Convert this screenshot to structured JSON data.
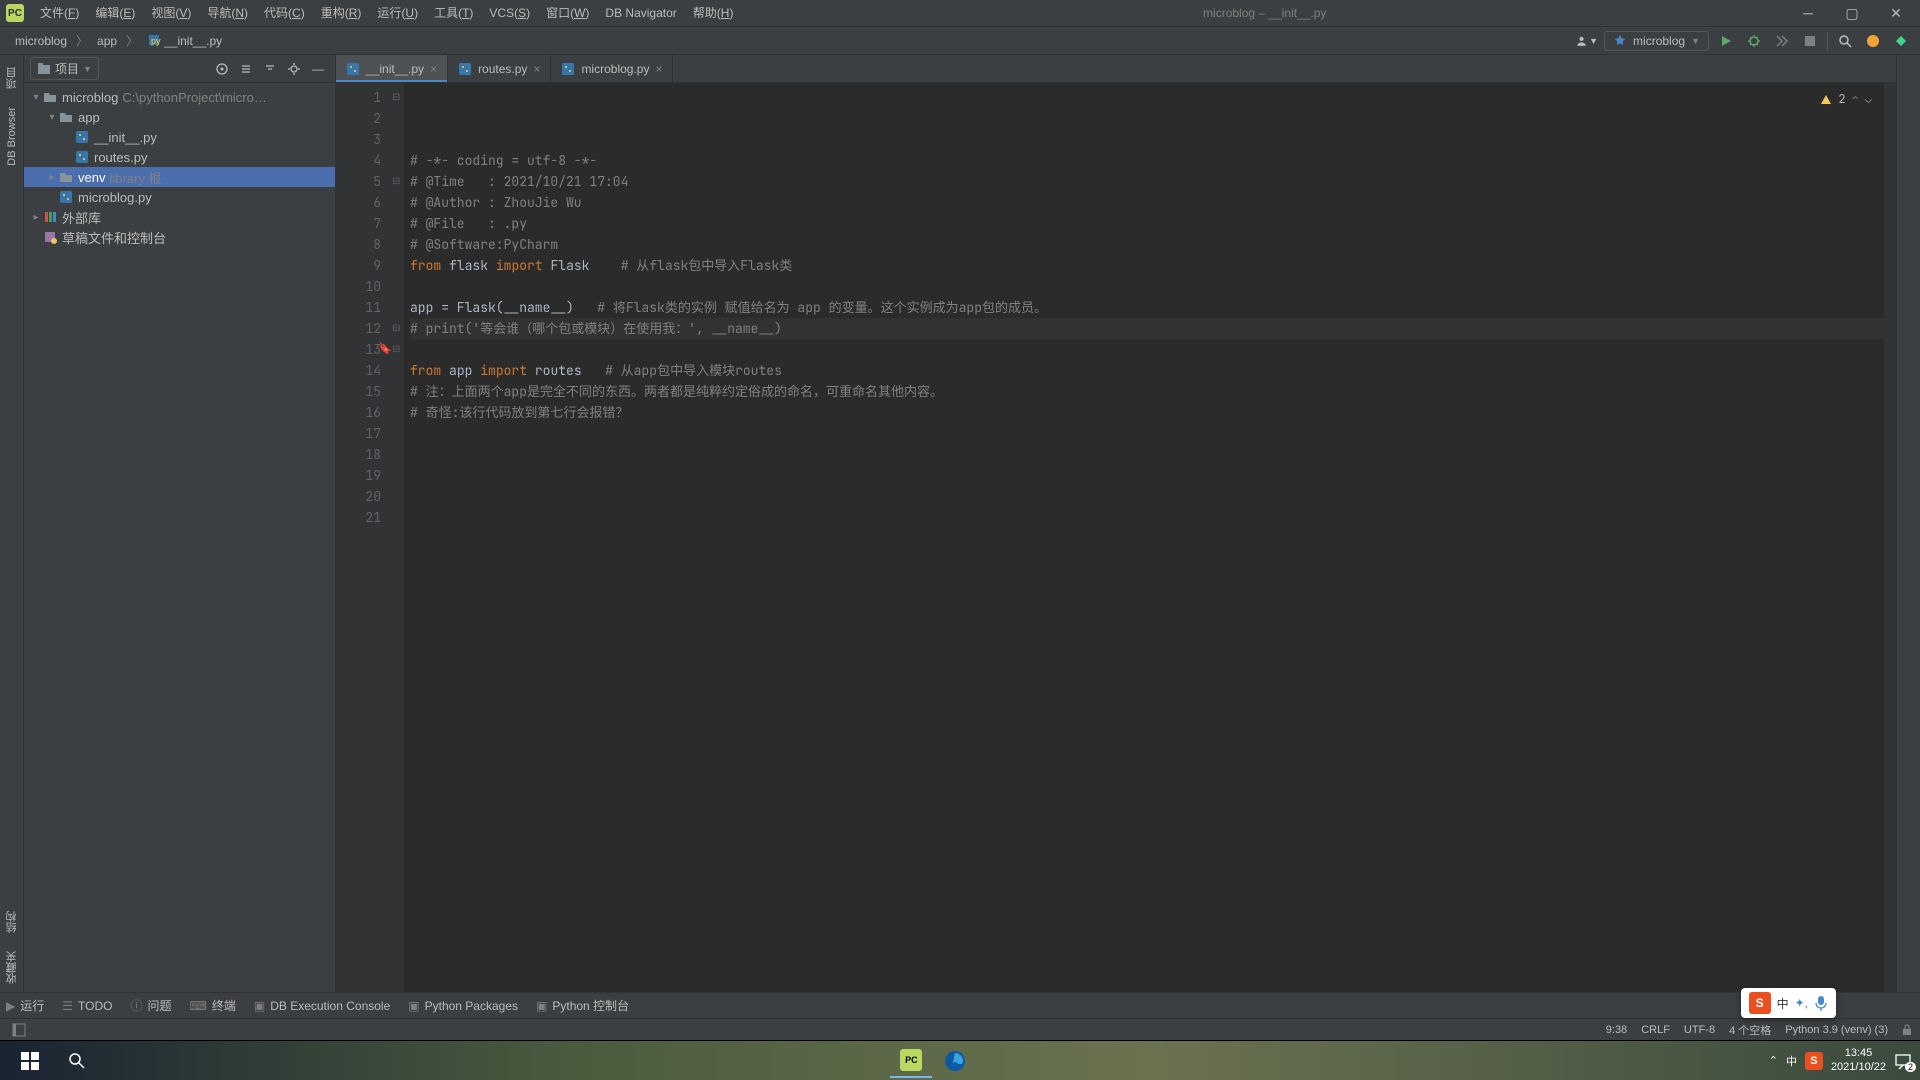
{
  "window": {
    "title": "microblog – __init__.py"
  },
  "menu": [
    "文件(F)",
    "编辑(E)",
    "视图(V)",
    "导航(N)",
    "代码(C)",
    "重构(R)",
    "运行(U)",
    "工具(T)",
    "VCS(S)",
    "窗口(W)",
    "DB Navigator",
    "帮助(H)"
  ],
  "breadcrumbs": [
    "microblog",
    "app",
    "__init__.py"
  ],
  "runConfig": {
    "name": "microblog"
  },
  "projectPanel": {
    "title": "项目",
    "tree": [
      {
        "depth": 0,
        "arrow": "▾",
        "icon": "folder",
        "label": "microblog",
        "dim": "C:\\pythonProject\\micro…"
      },
      {
        "depth": 1,
        "arrow": "▾",
        "icon": "folder",
        "label": "app"
      },
      {
        "depth": 2,
        "arrow": "",
        "icon": "py",
        "label": "__init__.py"
      },
      {
        "depth": 2,
        "arrow": "",
        "icon": "py",
        "label": "routes.py"
      },
      {
        "depth": 1,
        "arrow": "▸",
        "icon": "folder",
        "label": "venv",
        "dim": "library 根",
        "selected": true
      },
      {
        "depth": 1,
        "arrow": "",
        "icon": "py",
        "label": "microblog.py"
      },
      {
        "depth": 0,
        "arrow": "▸",
        "icon": "libs",
        "label": "外部库"
      },
      {
        "depth": 0,
        "arrow": "",
        "icon": "scratch",
        "label": "草稿文件和控制台"
      }
    ]
  },
  "leftGutter": {
    "project": "项目",
    "structure": "结构",
    "favorites": "收藏夹",
    "db": "DB Browser"
  },
  "tabs": [
    {
      "label": "__init__.py",
      "active": true
    },
    {
      "label": "routes.py",
      "active": false
    },
    {
      "label": "microblog.py",
      "active": false
    }
  ],
  "code": {
    "lines": [
      {
        "n": 1,
        "html": "<span class='com'># -*- coding = utf-8 -*-</span>"
      },
      {
        "n": 2,
        "html": "<span class='com'># @Time   : 2021/10/21 17:04</span>"
      },
      {
        "n": 3,
        "html": "<span class='com'># @Author : ZhouJie Wu</span>"
      },
      {
        "n": 4,
        "html": "<span class='com'># @File   : .py</span>"
      },
      {
        "n": 5,
        "html": "<span class='com'># @Software:PyCharm</span>"
      },
      {
        "n": 6,
        "html": "<span class='kw'>from</span> <span class='id'>flask</span> <span class='kw'>import</span> <span class='id'>Flask</span>    <span class='com'># 从flask包中导入Flask类</span>"
      },
      {
        "n": 7,
        "html": ""
      },
      {
        "n": 8,
        "html": "<span class='id'>app = Flask(__name__)</span>   <span class='com'># 将Flask类的实例 赋值给名为 app 的变量。这个实例成为app包的成员。</span>"
      },
      {
        "n": 9,
        "html": "<span class='com'># print('等会谁（哪个包或模块）在使用我：', __name__)</span>",
        "current": true
      },
      {
        "n": 10,
        "html": ""
      },
      {
        "n": 11,
        "html": "<span class='kw'>from</span> <span class='id'>app</span> <span class='kw'>import</span> <span class='id'>routes</span>   <span class='com'># 从app包中导入模块routes</span>"
      },
      {
        "n": 12,
        "html": "<span class='com'># 注：上面两个app是完全不同的东西。两者都是纯粹约定俗成的命名，可重命名其他内容。</span>"
      },
      {
        "n": 13,
        "html": "<span class='com'># 奇怪:该行代码放到第七行会报错？</span>",
        "bookmark": true
      },
      {
        "n": 14,
        "html": ""
      },
      {
        "n": 15,
        "html": ""
      },
      {
        "n": 16,
        "html": ""
      },
      {
        "n": 17,
        "html": ""
      },
      {
        "n": 18,
        "html": ""
      },
      {
        "n": 19,
        "html": ""
      },
      {
        "n": 20,
        "html": ""
      },
      {
        "n": 21,
        "html": ""
      }
    ],
    "inspection": {
      "warnings": 2
    }
  },
  "bottomTools": [
    "运行",
    "TODO",
    "问题",
    "终端",
    "DB Execution Console",
    "Python Packages",
    "Python 控制台"
  ],
  "status": {
    "pos": "9:38",
    "eol": "CRLF",
    "encoding": "UTF-8",
    "indent": "4 个空格",
    "interpreter": "Python 3.9 (venv) (3)"
  },
  "taskbar": {
    "time": "13:45",
    "date": "2021/10/22",
    "notifications": "2"
  },
  "ime": {
    "lang": "中"
  }
}
